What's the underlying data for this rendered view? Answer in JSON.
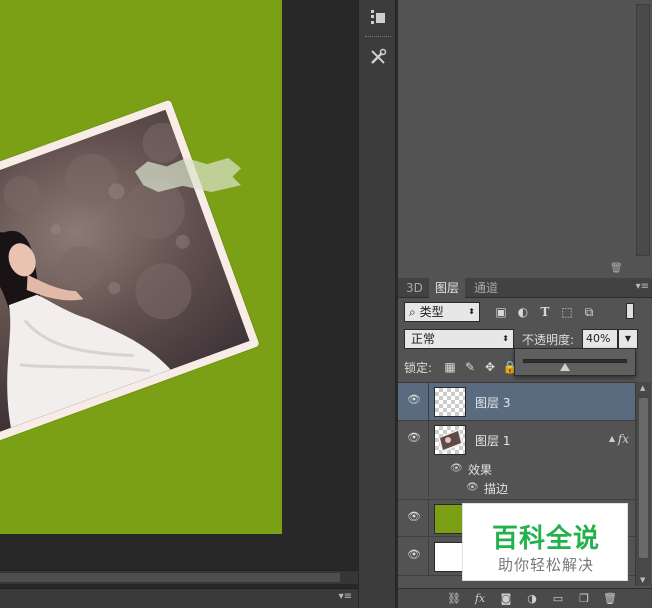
{
  "canvas": {
    "background_color": "#7ba016",
    "menu_icon": "panel-menu-icon"
  },
  "tool_strip": {
    "items": [
      {
        "icon": "character-panel-icon"
      },
      {
        "icon": "tools-preset-icon"
      }
    ]
  },
  "layers_panel": {
    "tabs": [
      {
        "label": "3D"
      },
      {
        "label": "图层"
      },
      {
        "label": "通道"
      }
    ],
    "active_tab": "图层",
    "filter": {
      "kind_label": "类型",
      "icons": [
        "image-filter-icon",
        "adjustment-filter-icon",
        "type-filter-icon",
        "shape-filter-icon",
        "smart-object-filter-icon"
      ]
    },
    "blend_mode": "正常",
    "opacity_label": "不透明度:",
    "opacity_value": "40%",
    "opacity_slider_fraction": 0.4,
    "lock_label": "锁定:",
    "lock_icons": [
      "lock-transparent-icon",
      "lock-paint-icon",
      "lock-move-icon",
      "lock-all-icon"
    ],
    "layers": [
      {
        "name": "图层 3",
        "selected": true,
        "visible": true,
        "has_fx": false
      },
      {
        "name": "图层 1",
        "selected": false,
        "visible": true,
        "has_fx": true
      }
    ],
    "effects": {
      "label": "效果",
      "items": [
        "描边"
      ]
    },
    "lower_layers": [
      {
        "fill": "#7ba016"
      },
      {
        "fill": "#ffffff"
      }
    ],
    "selected_color": "#5a6b80",
    "bottom_icons": [
      "link-layers-icon",
      "fx-icon",
      "add-mask-icon",
      "adjustment-layer-icon",
      "new-group-icon",
      "new-layer-icon",
      "delete-layer-icon"
    ]
  },
  "watermark": {
    "title": "百科全说",
    "subtitle": "助你轻松解决",
    "title_color": "#22b14c"
  }
}
